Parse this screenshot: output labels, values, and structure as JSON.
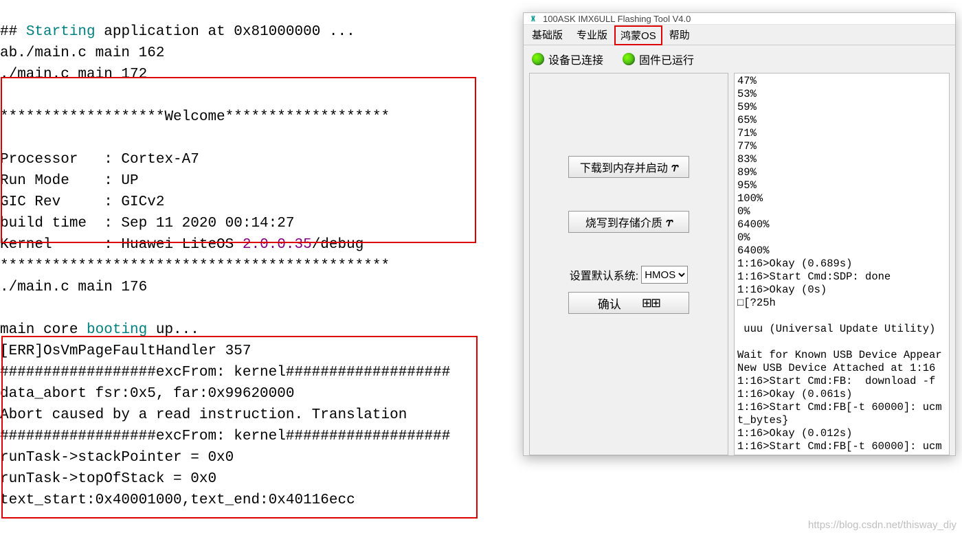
{
  "terminal": {
    "l1_pre": "## ",
    "l1_hl": "Starting",
    "l1_post": " application at 0x81000000 ...",
    "l2": "ab./main.c main 162",
    "l3": "./main.c main 172",
    "l4": "",
    "l5": "*******************Welcome*******************",
    "l6": "",
    "l7": "Processor   : Cortex-A7",
    "l8": "Run Mode    : UP",
    "l9": "GIC Rev     : GICv2",
    "l10": "build time  : Sep 11 2020 00:14:27",
    "l11_pre": "Kernel      : Huawei LiteOS ",
    "l11_hl": "2.0.0.35",
    "l11_post": "/debug",
    "l12": "*********************************************",
    "l13": "./main.c main 176",
    "l14": "",
    "l15_pre": "main core ",
    "l15_hl": "booting",
    "l15_post": " up...",
    "l16": "[ERR]OsVmPageFaultHandler 357",
    "l17": "##################excFrom: kernel###################",
    "l18": "data_abort fsr:0x5, far:0x99620000",
    "l19": "Abort caused by a read instruction. Translation ",
    "l20": "##################excFrom: kernel###################",
    "l21": "runTask->stackPointer = 0x0",
    "l22": "runTask->topOfStack = 0x0",
    "l23": "text_start:0x40001000,text_end:0x40116ecc"
  },
  "tool": {
    "title": "100ASK IMX6ULL Flashing Tool V4.0",
    "icon_text": "🝏",
    "tabs": [
      "基础版",
      "专业版",
      "鸿蒙OS",
      "帮助"
    ],
    "active_tab_index": 2,
    "status": {
      "device": "设备已连接",
      "firmware": "固件已运行"
    },
    "buttons": {
      "download": "下载到内存并启动",
      "burn": "烧写到存储介质",
      "confirm": "确认",
      "zap": "⥾"
    },
    "select": {
      "label": "设置默认系统:",
      "selected": "HMOS",
      "options": [
        "HMOS"
      ]
    },
    "grid_icon": "⊞⊞",
    "log": [
      "47%",
      "53%",
      "59%",
      "65%",
      "71%",
      "77%",
      "83%",
      "89%",
      "95%",
      "100%",
      "0%",
      "6400%",
      "0%",
      "6400%",
      "1:16>Okay (0.689s)",
      "1:16>Start Cmd:SDP: done",
      "1:16>Okay (0s)",
      "□[?25h",
      "",
      " uuu (Universal Update Utility) ",
      "",
      "Wait for Known USB Device Appear",
      "New USB Device Attached at 1:16",
      "1:16>Start Cmd:FB:  download -f",
      "1:16>Okay (0.061s)",
      "1:16>Start Cmd:FB[-t 60000]: ucm",
      "t_bytes}",
      "1:16>Okay (0.012s)",
      "1:16>Start Cmd:FB[-t 60000]: ucm"
    ]
  },
  "watermark": "https://blog.csdn.net/thisway_diy"
}
